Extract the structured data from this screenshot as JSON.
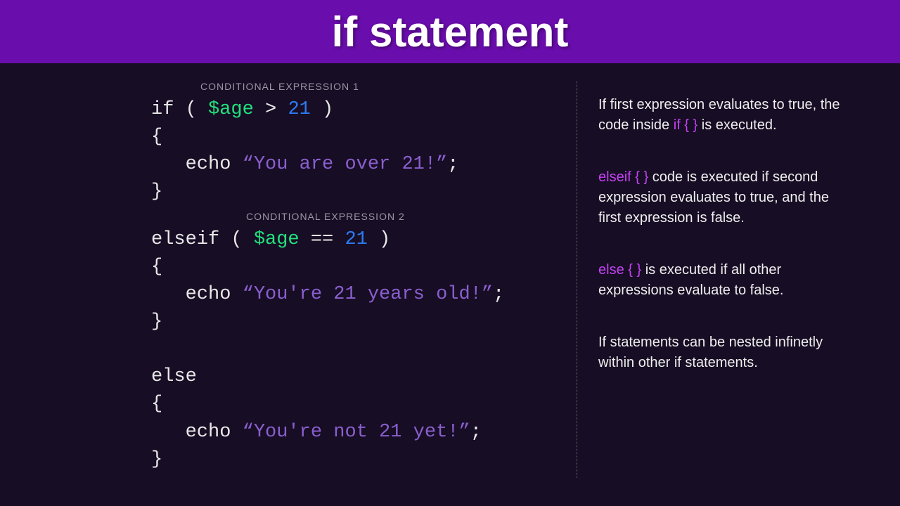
{
  "header": {
    "title": "if statement"
  },
  "labels": {
    "cond1": "CONDITIONAL EXPRESSION 1",
    "cond2": "CONDITIONAL EXPRESSION 2"
  },
  "code": {
    "if_kw": "if",
    "open_paren": " ( ",
    "var": "$age",
    "gt_space": " > ",
    "num21": "21",
    "close_paren": " )",
    "brace_open": "{",
    "brace_close": "}",
    "echo_indent": "   echo ",
    "str1": "“You are over 21!”",
    "semicolon": ";",
    "elseif_kw": "elseif",
    "eqeq_space": " == ",
    "str2": "“You're 21 years old!”",
    "else_kw": "else",
    "str3": "“You're not 21 yet!”"
  },
  "explain": {
    "p1a": "If first expression evaluates to true, the code inside ",
    "p1kw": "if { }",
    "p1b": " is executed.",
    "p2kw": "elseif { }",
    "p2a": " code is executed if second expression evaluates to true, and the first expression is false.",
    "p3kw": "else { }",
    "p3a": " is executed if all other expressions evaluate to false.",
    "p4": "If statements can be nested infinetly within other if statements."
  }
}
